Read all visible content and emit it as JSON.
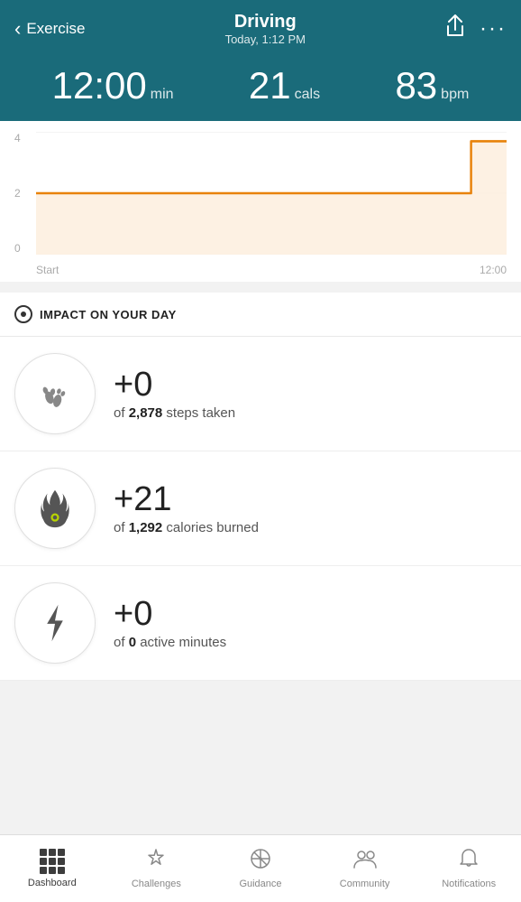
{
  "header": {
    "back_label": "Exercise",
    "title": "Driving",
    "subtitle": "Today, 1:12 PM",
    "share_icon": "⬆",
    "more_icon": "···"
  },
  "stats": {
    "time_value": "12:00",
    "time_unit": "min",
    "cals_value": "21",
    "cals_unit": "cals",
    "bpm_value": "83",
    "bpm_unit": "bpm"
  },
  "chart": {
    "y_labels": [
      "4",
      "2",
      "0"
    ],
    "x_labels": [
      "Start",
      "12:00"
    ]
  },
  "impact": {
    "section_title": "IMPACT ON YOUR DAY",
    "items": [
      {
        "value": "+0",
        "desc_prefix": "of ",
        "desc_bold": "2,878",
        "desc_suffix": " steps taken",
        "icon": "footprint"
      },
      {
        "value": "+21",
        "desc_prefix": "of ",
        "desc_bold": "1,292",
        "desc_suffix": " calories burned",
        "icon": "flame"
      },
      {
        "value": "+0",
        "desc_prefix": "of ",
        "desc_bold": "0",
        "desc_suffix": " active minutes",
        "icon": "bolt"
      }
    ]
  },
  "nav": {
    "items": [
      {
        "id": "dashboard",
        "label": "Dashboard",
        "active": true
      },
      {
        "id": "challenges",
        "label": "Challenges",
        "active": false
      },
      {
        "id": "guidance",
        "label": "Guidance",
        "active": false
      },
      {
        "id": "community",
        "label": "Community",
        "active": false
      },
      {
        "id": "notifications",
        "label": "Notifications",
        "active": false
      }
    ]
  }
}
